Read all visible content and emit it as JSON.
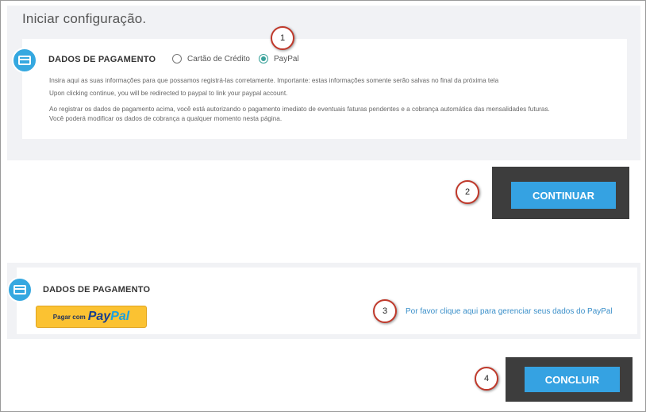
{
  "page": {
    "title": "Iniciar configuração."
  },
  "payment_section": {
    "heading": "DADOS DE PAGAMENTO",
    "icon": "credit-card-icon",
    "options": [
      {
        "label": "Cartão de Crédito",
        "selected": false
      },
      {
        "label": "PayPal",
        "selected": true
      }
    ],
    "info_lines": [
      "Insira aqui as suas informações para que possamos registrá-las corretamente. Importante: estas informações somente serão salvas no final da próxima tela",
      "Upon clicking continue, you will be redirected to paypal to link your paypal account.",
      "Ao registrar os dados de pagamento acima, você está autorizando o pagamento imediato de eventuais faturas pendentes e a cobrança automática das mensalidades futuras.",
      "Você poderá modificar os dados de cobrança a qualquer momento nesta página."
    ]
  },
  "continue_button": {
    "label": "CONTINUAR"
  },
  "payment_section2": {
    "heading": "DADOS DE PAGAMENTO",
    "icon": "credit-card-icon",
    "paypal_button": {
      "prefix": "Pagar com",
      "brand_part1": "Pay",
      "brand_part2": "Pal"
    },
    "manage_link": "Por favor clique aqui para gerenciar seus dados do PayPal"
  },
  "finish_button": {
    "label": "CONCLUIR"
  },
  "step_badges": [
    "1",
    "2",
    "3",
    "4"
  ],
  "colors": {
    "accent": "#35a2e2",
    "badge_border": "#c0392b",
    "panel_bg": "#f1f2f5",
    "paypal_yellow": "#fbc232"
  }
}
